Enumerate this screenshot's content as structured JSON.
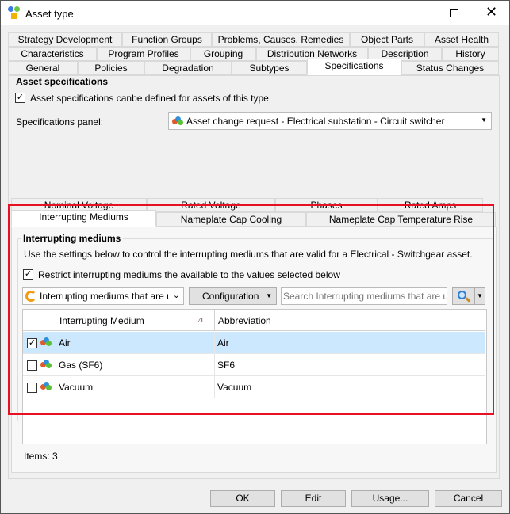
{
  "window": {
    "title": "Asset type",
    "minimize_icon": "minimize-icon",
    "maximize_icon": "maximize-icon",
    "close_icon": "close-icon"
  },
  "tabs": {
    "row1": [
      "Strategy Development",
      "Function Groups",
      "Problems, Causes, Remedies",
      "Object Parts",
      "Asset Health"
    ],
    "row2": [
      "Characteristics",
      "Program Profiles",
      "Grouping",
      "Distribution Networks",
      "Description",
      "History"
    ],
    "row3": [
      "General",
      "Policies",
      "Degradation",
      "Subtypes",
      "Specifications",
      "Status Changes"
    ],
    "active": "Specifications"
  },
  "asset_specs": {
    "group_title": "Asset specifications",
    "checkbox_label": "Asset specifications canbe defined for assets of this type",
    "checked": true,
    "panel_label": "Specifications panel:",
    "panel_value": "Asset change request - Electrical substation - Circuit switcher"
  },
  "inner_tabs": {
    "row1": [
      "Nominal Voltage",
      "Rated Voltage",
      "Phases",
      "Rated Amps"
    ],
    "row2": [
      "Interrupting Mediums",
      "Nameplate Cap Cooling",
      "Nameplate Cap Temperature Rise"
    ],
    "active": "Interrupting Mediums"
  },
  "mediums": {
    "group_title": "Interrupting mediums",
    "description": "Use the settings below to control the interrupting mediums that are valid for a Electrical - Switchgear asset.",
    "restrict_label": "Restrict interrupting mediums the available to the values selected below",
    "restrict_checked": true,
    "view_select": "Interrupting mediums that are use",
    "configuration_label": "Configuration",
    "search_placeholder": "Search Interrupting mediums that are used",
    "columns": [
      "Interrupting Medium",
      "Abbreviation"
    ],
    "sort_indicator": "1",
    "rows": [
      {
        "checked": true,
        "name": "Air",
        "abbr": "Air",
        "selected": true
      },
      {
        "checked": false,
        "name": "Gas (SF6)",
        "abbr": "SF6",
        "selected": false
      },
      {
        "checked": false,
        "name": "Vacuum",
        "abbr": "Vacuum",
        "selected": false
      }
    ],
    "items_count": "Items: 3"
  },
  "buttons": {
    "ok": "OK",
    "edit": "Edit",
    "usage": "Usage...",
    "cancel": "Cancel"
  },
  "colors": {
    "highlight": "#e81123",
    "selected_row": "#cce8ff"
  }
}
